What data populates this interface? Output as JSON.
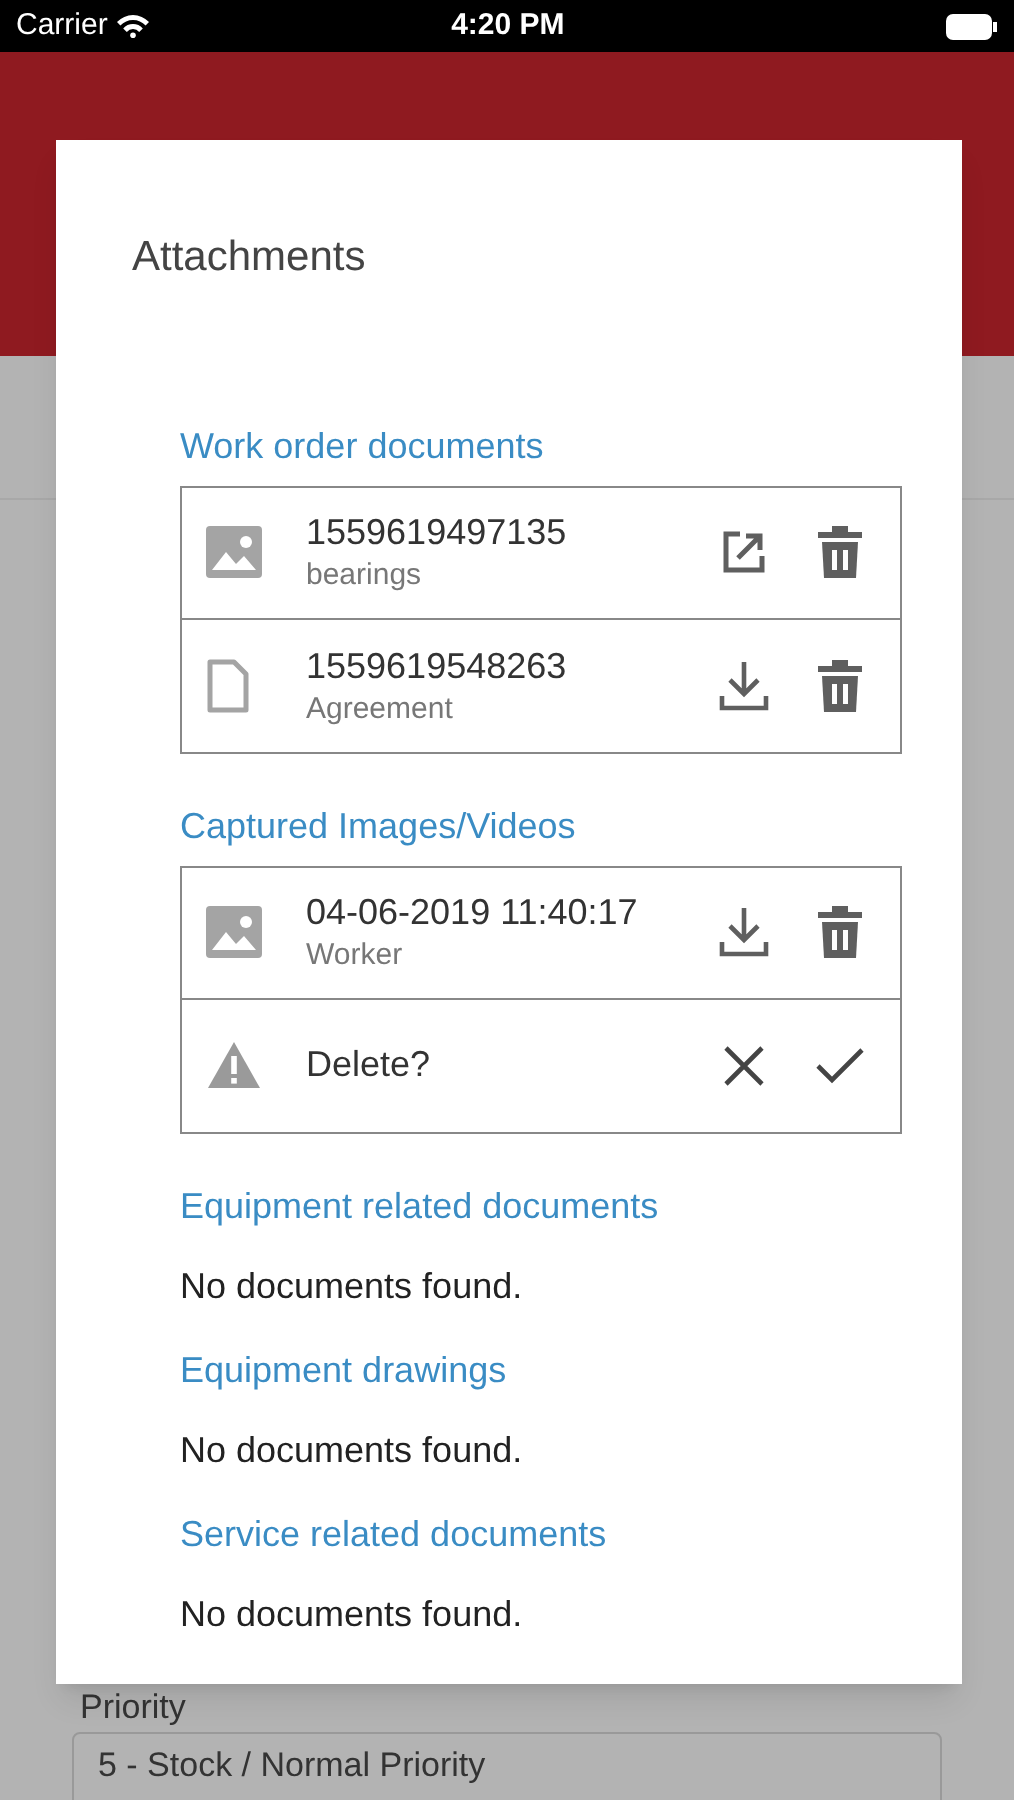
{
  "status_bar": {
    "carrier": "Carrier",
    "time": "4:20 PM"
  },
  "background": {
    "priority_label": "Priority",
    "priority_value": "5 - Stock / Normal Priority"
  },
  "dialog": {
    "title": "Attachments",
    "sections": [
      {
        "title": "Work order documents",
        "items": [
          {
            "kind": "image",
            "name": "1559619497135",
            "subtitle": "bearings",
            "actions": [
              {
                "kind": "open"
              },
              {
                "kind": "delete"
              }
            ]
          },
          {
            "kind": "file",
            "name": "1559619548263",
            "subtitle": "Agreement",
            "actions": [
              {
                "kind": "download"
              },
              {
                "kind": "delete"
              }
            ]
          }
        ]
      },
      {
        "title": "Captured Images/Videos",
        "items": [
          {
            "kind": "image",
            "name": "04-06-2019 11:40:17",
            "subtitle": "Worker",
            "actions": [
              {
                "kind": "download"
              },
              {
                "kind": "delete"
              }
            ]
          },
          {
            "kind": "confirm",
            "name": "Delete?",
            "actions": [
              {
                "kind": "cancel"
              },
              {
                "kind": "confirm"
              }
            ]
          }
        ]
      },
      {
        "title": "Equipment related documents",
        "empty": "No documents found."
      },
      {
        "title": "Equipment drawings",
        "empty": "No documents found."
      },
      {
        "title": "Service related documents",
        "empty": "No documents found."
      }
    ]
  }
}
